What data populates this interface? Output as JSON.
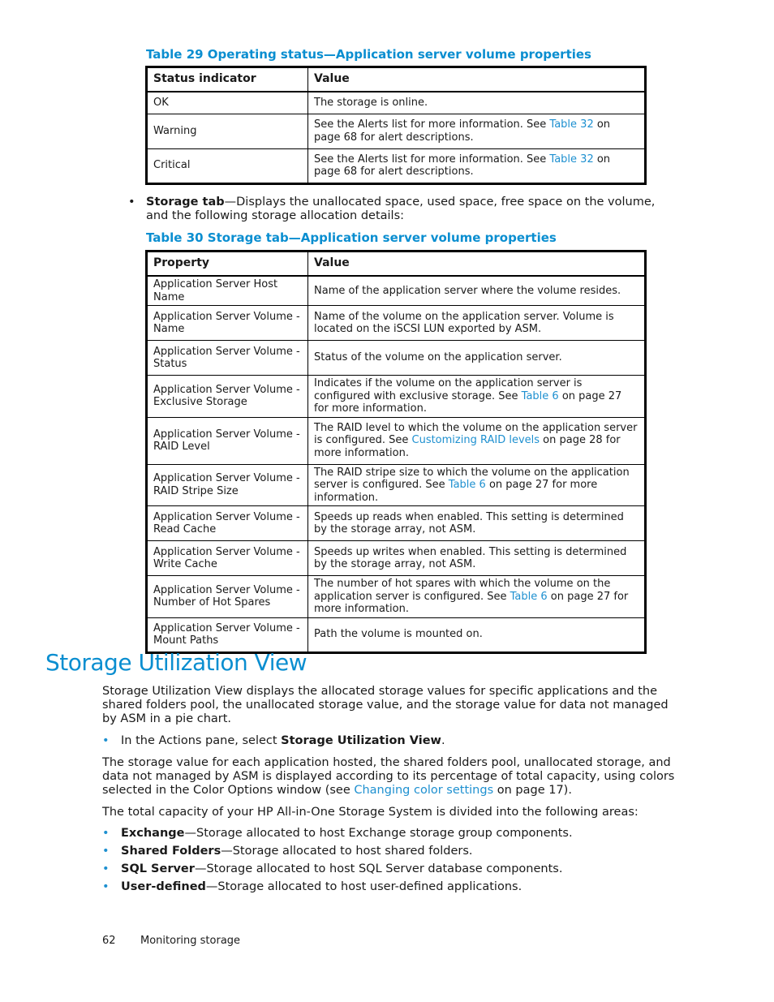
{
  "table29": {
    "caption": "Table 29 Operating status—Application server volume properties",
    "headers": [
      "Status indicator",
      "Value"
    ],
    "rows": [
      {
        "property": "OK",
        "value": "The storage is online."
      },
      {
        "property": "Warning",
        "value_pre": "See the Alerts list for more information.  See ",
        "link": "Table 32",
        "value_post": " on page 68 for alert descriptions."
      },
      {
        "property": "Critical",
        "value_pre": "See the Alerts list for more information.  See ",
        "link": "Table 32",
        "value_post": " on page 68 for alert descriptions."
      }
    ]
  },
  "storage_tab_bullet": {
    "bullet": "•",
    "bold": "Storage tab",
    "text": "—Displays the unallocated space, used space, free space on the volume, and the following storage allocation details:"
  },
  "table30": {
    "caption": "Table 30 Storage tab—Application server volume properties",
    "headers": [
      "Property",
      "Value"
    ],
    "rows": [
      {
        "property": "Application Server Host Name",
        "value_pre": "Name of the application server where the volume resides.",
        "link": "",
        "value_post": ""
      },
      {
        "property": "Application Server Volume - Name",
        "value_pre": "Name of the volume on the application server.  Volume is located on the iSCSI LUN exported by ASM.",
        "link": "",
        "value_post": ""
      },
      {
        "property": "Application Server Volume - Status",
        "value_pre": "Status of the volume on the application server.",
        "link": "",
        "value_post": ""
      },
      {
        "property": "Application Server Volume - Exclusive Storage",
        "value_pre": "Indicates if the volume on the application server is configured with exclusive storage.  See ",
        "link": "Table 6",
        "value_post": " on page 27 for more information."
      },
      {
        "property": "Application Server Volume - RAID Level",
        "value_pre": "The RAID level to which the volume on the application server is configured.  See ",
        "link": "Customizing RAID levels",
        "value_post": " on page 28 for more information."
      },
      {
        "property": "Application Server Volume - RAID Stripe Size",
        "value_pre": "The RAID stripe size to which the volume on the application server is configured.  See ",
        "link": "Table 6",
        "value_post": " on page 27 for more information."
      },
      {
        "property": "Application Server Volume - Read Cache",
        "value_pre": "Speeds up reads when enabled.  This setting is determined by the storage array, not ASM.",
        "link": "",
        "value_post": ""
      },
      {
        "property": "Application Server Volume - Write Cache",
        "value_pre": "Speeds up writes when enabled.  This setting is determined by the storage array, not ASM.",
        "link": "",
        "value_post": ""
      },
      {
        "property": "Application Server Volume - Number of Hot Spares",
        "value_pre": "The number of hot spares with which the volume on the application server is configured.  See ",
        "link": "Table 6",
        "value_post": " on page 27 for more information."
      },
      {
        "property": "Application Server Volume - Mount Paths",
        "value_pre": "Path the volume is mounted on.",
        "link": "",
        "value_post": ""
      }
    ]
  },
  "section": {
    "title": "Storage Utilization View",
    "intro": "Storage Utilization View displays the allocated storage values for specific applications and the shared folders pool, the unallocated storage value, and the storage value for data not managed by ASM in a pie chart.",
    "step": {
      "pre": "In the Actions pane, select ",
      "bold": "Storage Utilization View",
      "post": "."
    },
    "para2_pre": "The storage value for each application hosted, the shared folders pool, unallocated storage, and data not managed by ASM is displayed according to its percentage of total capacity, using colors selected in the Color Options window (see ",
    "para2_link": "Changing color settings",
    "para2_post": " on page 17).",
    "para3": "The total capacity of your HP All-in-One Storage System is divided into the following areas:",
    "areas": [
      {
        "bold": "Exchange",
        "text": "—Storage allocated to host Exchange storage group components."
      },
      {
        "bold": "Shared Folders",
        "text": "—Storage allocated to host shared folders."
      },
      {
        "bold": "SQL Server",
        "text": "—Storage allocated to host SQL Server database components."
      },
      {
        "bold": "User-defined",
        "text": "—Storage allocated to host user-defined applications."
      }
    ]
  },
  "footer": {
    "page_number": "62",
    "chapter": "Monitoring storage"
  },
  "colors": {
    "accent": "#0a8ed0",
    "link": "#1e90d0",
    "text": "#1a1a1a"
  }
}
